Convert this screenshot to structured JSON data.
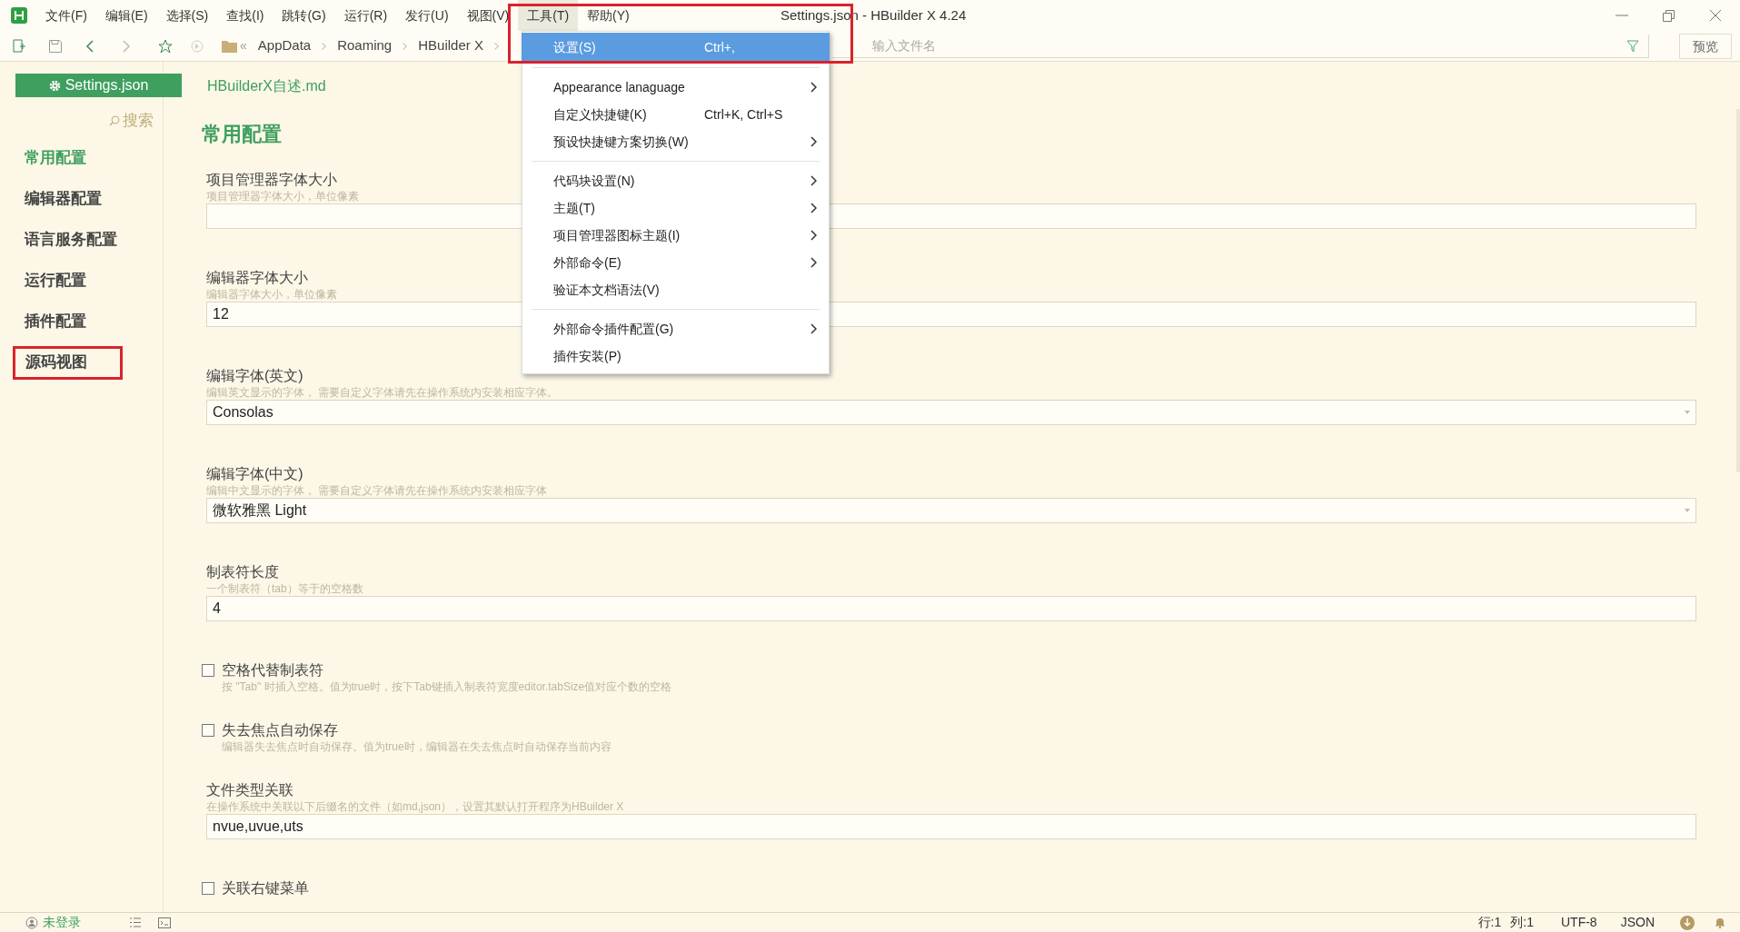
{
  "window": {
    "title": "Settings.json - HBuilder X 4.24"
  },
  "menu_bar": [
    {
      "label": "文件(F)",
      "selected": false,
      "highlighted": false
    },
    {
      "label": "编辑(E)",
      "selected": false,
      "highlighted": false
    },
    {
      "label": "选择(S)",
      "selected": false,
      "highlighted": false
    },
    {
      "label": "查找(I)",
      "selected": false,
      "highlighted": false
    },
    {
      "label": "跳转(G)",
      "selected": false,
      "highlighted": false
    },
    {
      "label": "运行(R)",
      "selected": false,
      "highlighted": false
    },
    {
      "label": "发行(U)",
      "selected": false,
      "highlighted": false
    },
    {
      "label": "视图(V)",
      "selected": false,
      "highlighted": false
    },
    {
      "label": "工具(T)",
      "selected": true,
      "highlighted": true
    },
    {
      "label": "帮助(Y)",
      "selected": false,
      "highlighted": false
    }
  ],
  "toolbar": {
    "breadcrumb_overflow": "«",
    "breadcrumb": [
      "AppData",
      "Roaming",
      "HBuilder X"
    ],
    "file_search": {
      "placeholder": "输入文件名"
    },
    "preview_button": "预览"
  },
  "dropdown_menu": {
    "items": [
      {
        "kind": "item",
        "label": "设置(S)",
        "shortcut": "Ctrl+,",
        "selected": true,
        "submenu": false
      },
      {
        "kind": "separator"
      },
      {
        "kind": "item",
        "label": "Appearance lanaguage",
        "selected": false,
        "submenu": true
      },
      {
        "kind": "item",
        "label": "自定义快捷键(K)",
        "shortcut": "Ctrl+K, Ctrl+S",
        "selected": false,
        "submenu": false
      },
      {
        "kind": "item",
        "label": "预设快捷键方案切换(W)",
        "selected": false,
        "submenu": true
      },
      {
        "kind": "separator"
      },
      {
        "kind": "item",
        "label": "代码块设置(N)",
        "selected": false,
        "submenu": true
      },
      {
        "kind": "item",
        "label": "主题(T)",
        "selected": false,
        "submenu": true
      },
      {
        "kind": "item",
        "label": "项目管理器图标主题(I)",
        "selected": false,
        "submenu": true
      },
      {
        "kind": "item",
        "label": "外部命令(E)",
        "selected": false,
        "submenu": true
      },
      {
        "kind": "item",
        "label": "验证本文档语法(V)",
        "selected": false,
        "submenu": false
      },
      {
        "kind": "separator"
      },
      {
        "kind": "item",
        "label": "外部命令插件配置(G)",
        "selected": false,
        "submenu": true
      },
      {
        "kind": "item",
        "label": "插件安装(P)",
        "selected": false,
        "submenu": false
      }
    ]
  },
  "editor_tabs": [
    {
      "label": "Settings.json",
      "selected": true
    },
    {
      "label": "HBuilderX自述.md",
      "selected": false
    }
  ],
  "sidebar": {
    "search": "搜索",
    "items": [
      {
        "label": "常用配置",
        "selected": true,
        "highlighted": false
      },
      {
        "label": "编辑器配置",
        "selected": false,
        "highlighted": false
      },
      {
        "label": "语言服务配置",
        "selected": false,
        "highlighted": false
      },
      {
        "label": "运行配置",
        "selected": false,
        "highlighted": false
      },
      {
        "label": "插件配置",
        "selected": false,
        "highlighted": false
      },
      {
        "label": "源码视图",
        "selected": false,
        "highlighted": true
      }
    ]
  },
  "settings": {
    "heading": "常用配置",
    "items": [
      {
        "kind": "input",
        "label": "项目管理器字体大小",
        "description": "项目管理器字体大小，单位像素"
      },
      {
        "kind": "input",
        "label": "编辑器字体大小",
        "description": "编辑器字体大小，单位像素",
        "value": "12"
      },
      {
        "kind": "select",
        "label": "编辑字体(英文)",
        "description": "编辑英文显示的字体， 需要自定义字体请先在操作系统内安装相应字体。",
        "value": "Consolas"
      },
      {
        "kind": "select",
        "label": "编辑字体(中文)",
        "description": "编辑中文显示的字体， 需要自定义字体请先在操作系统内安装相应字体",
        "value": "微软雅黑 Light"
      },
      {
        "kind": "input",
        "label": "制表符长度",
        "description": "一个制表符（tab）等于的空格数",
        "value": "4"
      },
      {
        "kind": "checkbox",
        "label": "空格代替制表符",
        "description": "按 \"Tab\" 时插入空格。值为true时，按下Tab键插入制表符宽度editor.tabSize值对应个数的空格",
        "checked": false
      },
      {
        "kind": "checkbox",
        "label": "失去焦点自动保存",
        "description": "编辑器失去焦点时自动保存。值为true时，编辑器在失去焦点时自动保存当前内容",
        "checked": false
      },
      {
        "kind": "input",
        "label": "文件类型关联",
        "description": "在操作系统中关联以下后缀名的文件（如md,json），设置其默认打开程序为HBuilder X",
        "value": "nvue,uvue,uts"
      },
      {
        "kind": "checkbox",
        "label": "关联右键菜单",
        "checked": false
      }
    ]
  },
  "status_bar": {
    "login": "未登录",
    "line": "行:1",
    "column": "列:1",
    "encoding": "UTF-8",
    "language": "JSON"
  }
}
